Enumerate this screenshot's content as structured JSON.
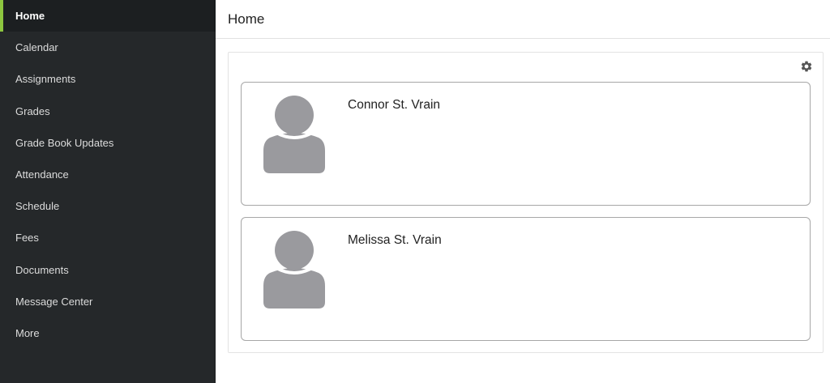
{
  "sidebar": {
    "items": [
      {
        "label": "Home",
        "active": true
      },
      {
        "label": "Calendar"
      },
      {
        "label": "Assignments"
      },
      {
        "label": "Grades"
      },
      {
        "label": "Grade Book Updates"
      },
      {
        "label": "Attendance"
      },
      {
        "label": "Schedule"
      },
      {
        "label": "Fees"
      },
      {
        "label": "Documents"
      },
      {
        "label": "Message Center"
      },
      {
        "label": "More"
      }
    ]
  },
  "header": {
    "title": "Home"
  },
  "students": [
    {
      "name": "Connor St. Vrain"
    },
    {
      "name": "Melissa St. Vrain"
    }
  ],
  "colors": {
    "sidebar_bg": "#25282a",
    "active_bg": "#1c1f21",
    "accent": "#8dc63f",
    "avatar_fill": "#9a9a9e",
    "gear": "#555555"
  },
  "icons": {
    "settings": "gear-icon",
    "student_avatar": "person-avatar-icon"
  }
}
